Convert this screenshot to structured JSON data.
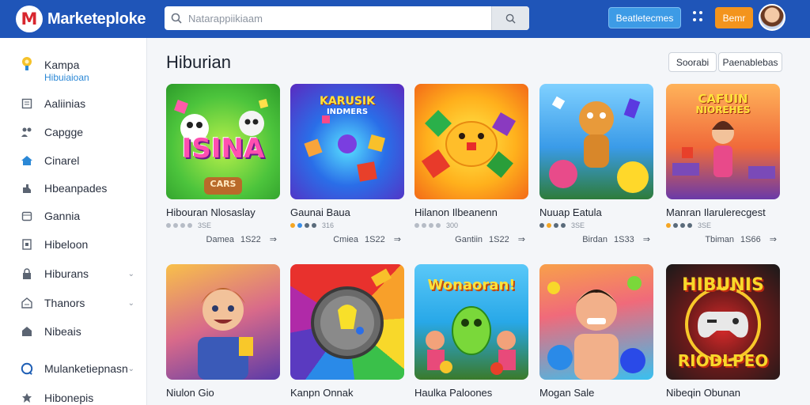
{
  "header": {
    "logo_letter": "M",
    "logo_text": "Marketeploke",
    "search_placeholder": "Natarappiikiaam",
    "primary_button": "Beatletecmes",
    "secondary_button": "Bemr",
    "colors": {
      "bar": "#1f55b8",
      "primary": "#3d9be6",
      "secondary": "#f3941d"
    }
  },
  "sidebar": {
    "items": [
      {
        "label": "Kampa",
        "sub": "Hibuiaioan",
        "icon": "lightbulb-icon"
      },
      {
        "label": "Aaliinias",
        "icon": "document-icon"
      },
      {
        "label": "Capgge",
        "icon": "people-icon"
      },
      {
        "label": "Cinarel",
        "icon": "home-icon"
      },
      {
        "label": "Hbeanpades",
        "icon": "puzzle-icon"
      },
      {
        "label": "Gannia",
        "icon": "calendar-icon"
      },
      {
        "label": "Hibeloon",
        "icon": "page-icon"
      },
      {
        "label": "Hiburans",
        "icon": "lock-icon",
        "chevron": true
      },
      {
        "label": "Thanors",
        "icon": "tag-icon",
        "chevron": true
      },
      {
        "label": "Nibeais",
        "icon": "house-icon"
      },
      {
        "label": "Mulanketiepnasn",
        "icon": "support-icon",
        "chevron": true
      },
      {
        "label": "Hibonepis",
        "icon": "settings-icon"
      }
    ]
  },
  "main": {
    "title": "Hiburian",
    "sort_label": "Soorabi",
    "filter_label": "Paenablebas",
    "cards": [
      {
        "title": "Hibouran Nlosaslay",
        "rating": "3SE",
        "cat": "Damea",
        "price": "1S22",
        "arrow": "⇒",
        "art": "ISINA",
        "sub_art": "CARS",
        "colors": [
          "#4cc43c",
          "#a7e24b",
          "#ff6ac2"
        ]
      },
      {
        "title": "Gaunai Baua",
        "rating": "316",
        "cat": "Cmiea",
        "price": "1S22",
        "arrow": "⇒",
        "art": "KARUSIK",
        "sub_art": "INDMERS",
        "colors": [
          "#2a4fd8",
          "#7a3ee0",
          "#20c0e8"
        ]
      },
      {
        "title": "Hilanon Ilbeanenn",
        "rating": "300",
        "cat": "Gantiin",
        "price": "1S22",
        "arrow": "⇒",
        "art": "",
        "sub_art": "",
        "colors": [
          "#ffcc2a",
          "#ff8f1c",
          "#f35a18"
        ]
      },
      {
        "title": "Nuuap Eatula",
        "rating": "3SE",
        "cat": "Birdan",
        "price": "1S33",
        "arrow": "⇒",
        "art": "",
        "sub_art": "",
        "colors": [
          "#3a9be8",
          "#f0a33c",
          "#e84b8a"
        ]
      },
      {
        "title": "Manran Ilarulerecgest",
        "rating": "3SE",
        "cat": "Tbiman",
        "price": "1S66",
        "arrow": "⇒",
        "art": "CAFUIN",
        "sub_art": "NIOREHES",
        "colors": [
          "#f06a3a",
          "#ffb74a",
          "#7b4ab8"
        ]
      },
      {
        "title": "Niulon Gio",
        "rating": "",
        "cat": "",
        "price": "",
        "arrow": "",
        "art": "",
        "sub_art": "",
        "colors": [
          "#f4a23a",
          "#b54aa8",
          "#3a6ed8"
        ]
      },
      {
        "title": "Kanpn Onnak",
        "rating": "",
        "cat": "",
        "price": "",
        "arrow": "",
        "art": "",
        "sub_art": "",
        "colors": [
          "#e8312d",
          "#2a8ae8",
          "#f8c82a"
        ]
      },
      {
        "title": "Haulka Paloones",
        "rating": "",
        "cat": "",
        "price": "",
        "arrow": "",
        "art": "Wonaoran!",
        "sub_art": "",
        "colors": [
          "#28a8e8",
          "#7ad83a",
          "#f8c42a"
        ]
      },
      {
        "title": "Mogan Sale",
        "rating": "",
        "cat": "",
        "price": "",
        "arrow": "",
        "art": "",
        "sub_art": "",
        "colors": [
          "#38c0f0",
          "#f8a04a",
          "#e8407a"
        ]
      },
      {
        "title": "Nibeqin Obunan",
        "rating": "",
        "cat": "",
        "price": "",
        "arrow": "",
        "art": "HIBUNIS",
        "sub_art": "RIODLPEO",
        "colors": [
          "#1a1a1a",
          "#d82a2a",
          "#f8c82a"
        ]
      }
    ]
  }
}
